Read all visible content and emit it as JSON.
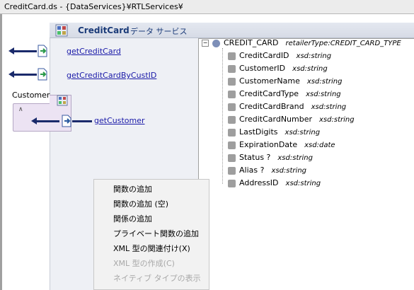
{
  "window": {
    "title": "CreditCard.ds - {DataServices}¥RTLServices¥"
  },
  "service": {
    "name": "CreditCard",
    "type_label": "データ サービス"
  },
  "functions": [
    {
      "label": "getCreditCard"
    },
    {
      "label": "getCreditCardByCustID"
    }
  ],
  "customer": {
    "label": "Customer",
    "function_label": "getCustomer"
  },
  "tree": {
    "root": {
      "name": "CREDIT_CARD",
      "type": "retailerType:CREDIT_CARD_TYPE",
      "expander": "−"
    },
    "fields": [
      {
        "name": "CreditCardID",
        "type": "xsd:string"
      },
      {
        "name": "CustomerID",
        "type": "xsd:string"
      },
      {
        "name": "CustomerName",
        "type": "xsd:string"
      },
      {
        "name": "CreditCardType",
        "type": "xsd:string"
      },
      {
        "name": "CreditCardBrand",
        "type": "xsd:string"
      },
      {
        "name": "CreditCardNumber",
        "type": "xsd:string"
      },
      {
        "name": "LastDigits",
        "type": "xsd:string"
      },
      {
        "name": "ExpirationDate",
        "type": "xsd:date"
      },
      {
        "name": "Status ?",
        "type": "xsd:string"
      },
      {
        "name": "Alias ?",
        "type": "xsd:string"
      },
      {
        "name": "AddressID",
        "type": "xsd:string"
      }
    ]
  },
  "context_menu": {
    "items": [
      {
        "label": "関数の追加",
        "enabled": true
      },
      {
        "label": "関数の追加 (空)",
        "enabled": true
      },
      {
        "label": "関係の追加",
        "enabled": true
      },
      {
        "label": "プライベート関数の追加",
        "enabled": true
      },
      {
        "label": "XML 型の関連付け(X)",
        "enabled": true
      },
      {
        "label": "XML 型の作成(C)",
        "enabled": false
      },
      {
        "label": "ネイティブ タイプの表示",
        "enabled": false
      }
    ]
  },
  "colors": {
    "link": "#1a1aa8",
    "arrow": "#1a2a6b",
    "customer_bg": "#ece3f3"
  },
  "icons": [
    "service-icon",
    "function-icon",
    "arrow-left-icon",
    "caret-up-icon"
  ]
}
